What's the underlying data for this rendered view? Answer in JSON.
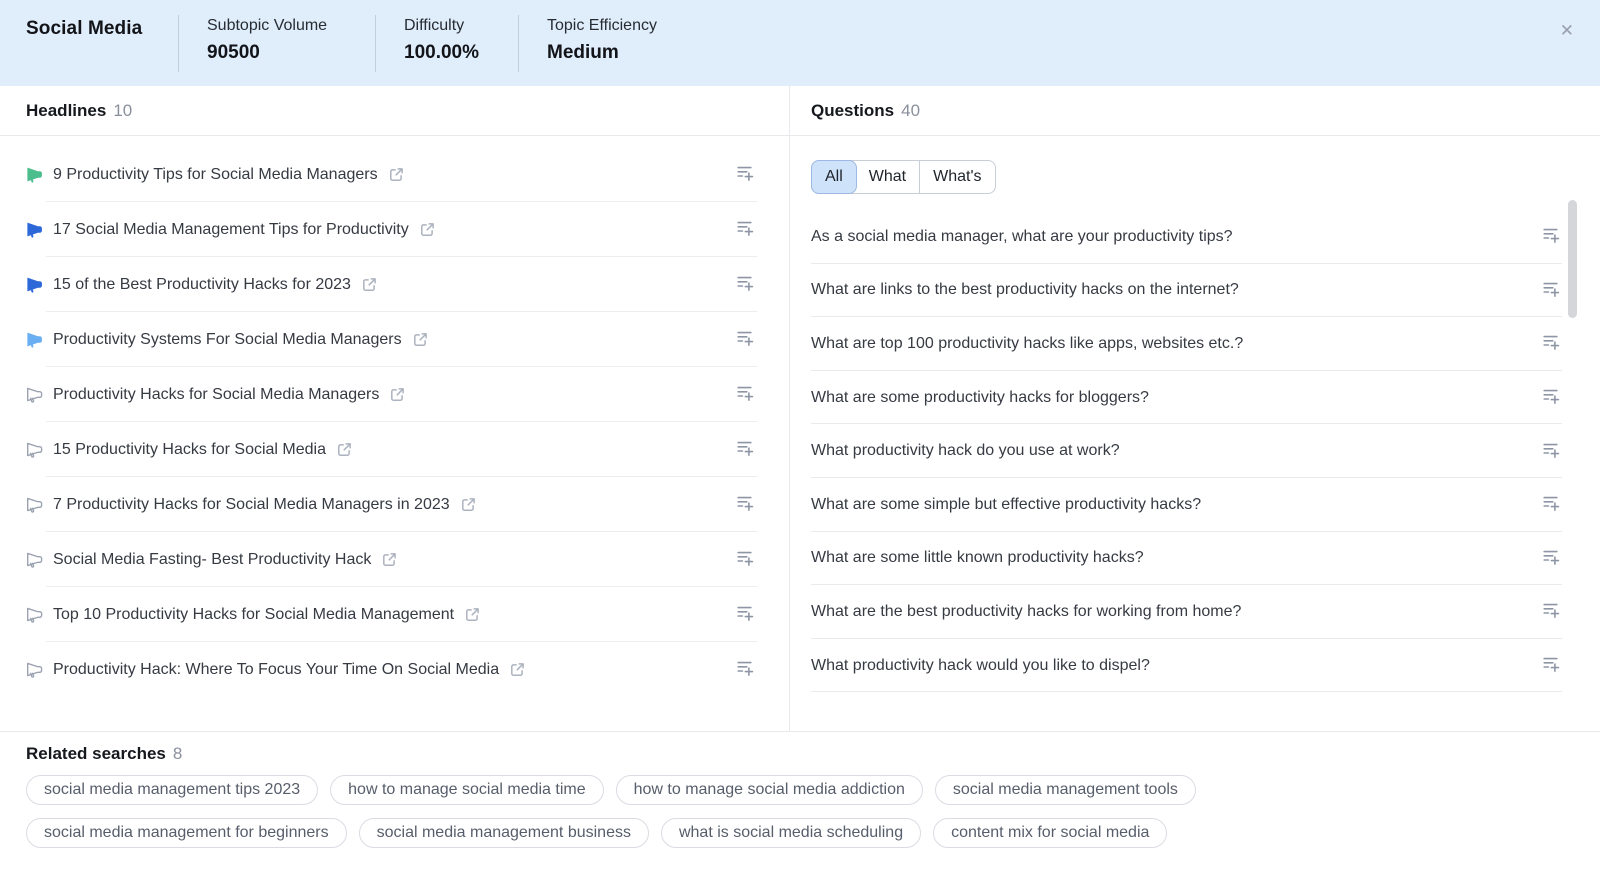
{
  "header": {
    "title": "Social Media",
    "close_glyph": "✕",
    "stats": [
      {
        "label": "Subtopic Volume",
        "value": "90500"
      },
      {
        "label": "Difficulty",
        "value": "100.00%"
      },
      {
        "label": "Topic Efficiency",
        "value": "Medium"
      }
    ]
  },
  "headlines": {
    "title": "Headlines",
    "count": "10",
    "items": [
      {
        "text": "9 Productivity Tips for Social Media Managers",
        "icon_variant": "green"
      },
      {
        "text": "17 Social Media Management Tips for Productivity",
        "icon_variant": "blue"
      },
      {
        "text": "15 of the Best Productivity Hacks for 2023",
        "icon_variant": "blue"
      },
      {
        "text": "Productivity Systems For Social Media Managers",
        "icon_variant": "light-blue"
      },
      {
        "text": "Productivity Hacks for Social Media Managers",
        "icon_variant": "gray"
      },
      {
        "text": "15 Productivity Hacks for Social Media",
        "icon_variant": "gray"
      },
      {
        "text": "7 Productivity Hacks for Social Media Managers in 2023",
        "icon_variant": "gray"
      },
      {
        "text": "Social Media Fasting- Best Productivity Hack",
        "icon_variant": "gray"
      },
      {
        "text": "Top 10 Productivity Hacks for Social Media Management",
        "icon_variant": "gray"
      },
      {
        "text": "Productivity Hack: Where To Focus Your Time On Social Media",
        "icon_variant": "gray"
      }
    ]
  },
  "questions": {
    "title": "Questions",
    "count": "40",
    "filters": [
      {
        "label": "All",
        "selected": true
      },
      {
        "label": "What",
        "selected": false
      },
      {
        "label": "What's",
        "selected": false
      }
    ],
    "items": [
      {
        "text": "As a social media manager, what are your productivity tips?"
      },
      {
        "text": "What are links to the best productivity hacks on the internet?"
      },
      {
        "text": "What are top 100 productivity hacks like apps, websites etc.?"
      },
      {
        "text": "What are some productivity hacks for bloggers?"
      },
      {
        "text": "What productivity hack do you use at work?"
      },
      {
        "text": "What are some simple but effective productivity hacks?"
      },
      {
        "text": "What are some little known productivity hacks?"
      },
      {
        "text": "What are the best productivity hacks for working from home?"
      },
      {
        "text": "What productivity hack would you like to dispel?"
      }
    ]
  },
  "related_searches": {
    "title": "Related searches",
    "count": "8",
    "items": [
      {
        "text": "social media management tips 2023"
      },
      {
        "text": "how to manage social media time"
      },
      {
        "text": "how to manage social media addiction"
      },
      {
        "text": "social media management tools"
      },
      {
        "text": "social media management for beginners"
      },
      {
        "text": "social media management business"
      },
      {
        "text": "what is social media scheduling"
      },
      {
        "text": "content mix for social media"
      }
    ]
  },
  "colors": {
    "header_bg": "#E0EDFA",
    "selected_filter_bg": "#CEE2F9",
    "headline_icon_green": "#4CBD8D",
    "headline_icon_blue": "#2D68D8",
    "headline_icon_light_blue": "#6AAFF2",
    "icon_gray": "#9BA2B0",
    "scrollbar_thumb": "#D4D6DA"
  }
}
